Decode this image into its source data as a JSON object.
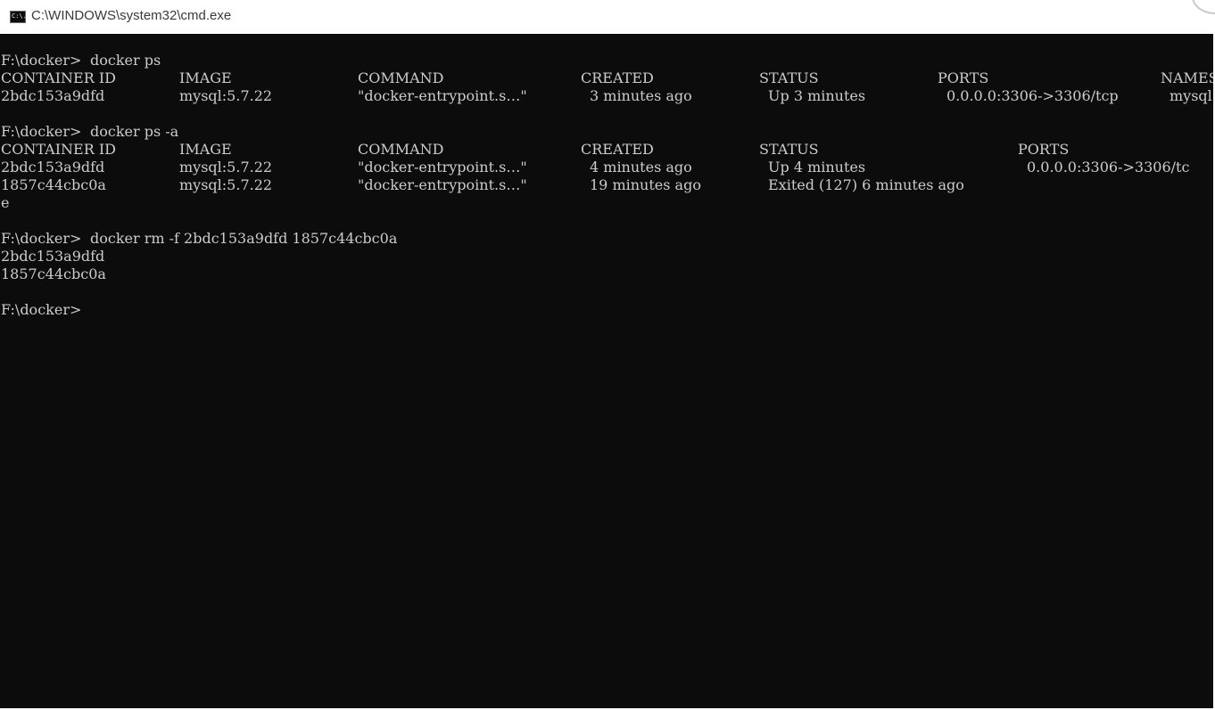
{
  "window": {
    "icon_label": "C:\\.",
    "title": "C:\\WINDOWS\\system32\\cmd.exe"
  },
  "console": {
    "prompt": "F:\\docker>",
    "cmd1": "docker ps",
    "ps_headers": [
      "CONTAINER ID",
      "IMAGE",
      "COMMAND",
      "CREATED",
      "STATUS",
      "PORTS",
      "NAMES"
    ],
    "ps_row": [
      "2bdc153a9dfd",
      "mysql:5.7.22",
      "\"docker-entrypoint.s…\"",
      "3 minutes ago",
      "Up 3 minutes",
      "0.0.0.0:3306->3306/tcp",
      "mysql"
    ],
    "cmd2": "docker ps -a",
    "psa_headers": [
      "CONTAINER ID",
      "IMAGE",
      "COMMAND",
      "CREATED",
      "STATUS",
      "PORTS"
    ],
    "psa_rows": [
      [
        "2bdc153a9dfd",
        "mysql:5.7.22",
        "\"docker-entrypoint.s…\"",
        "4 minutes ago",
        "Up 4 minutes",
        "0.0.0.0:3306->3306/tc"
      ],
      [
        "1857c44cbc0a",
        "mysql:5.7.22",
        "\"docker-entrypoint.s…\"",
        "19 minutes ago",
        "Exited (127) 6 minutes ago",
        ""
      ]
    ],
    "wrap_char": "e",
    "cmd3": "docker rm -f 2bdc153a9dfd 1857c44cbc0a",
    "rm_output": [
      "2bdc153a9dfd",
      "1857c44cbc0a"
    ],
    "final_prompt": "F:\\docker>"
  }
}
